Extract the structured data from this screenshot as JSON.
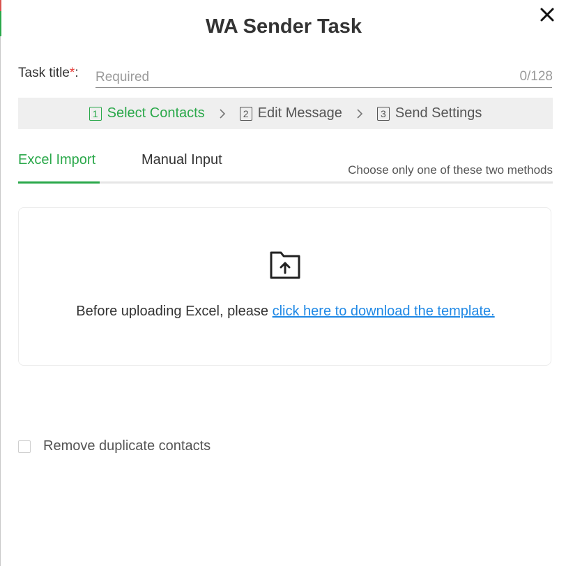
{
  "dialog": {
    "title": "WA Sender Task",
    "close_label": "✕"
  },
  "task_title": {
    "label": "Task title",
    "required_mark": "*",
    "colon": ":",
    "placeholder": "Required",
    "value": "",
    "counter": "0/128"
  },
  "steps": [
    {
      "number": "1",
      "label": "Select Contacts",
      "active": true
    },
    {
      "number": "2",
      "label": "Edit Message",
      "active": false
    },
    {
      "number": "3",
      "label": "Send Settings",
      "active": false
    }
  ],
  "tabs": {
    "items": [
      {
        "label": "Excel Import",
        "active": true
      },
      {
        "label": "Manual Input",
        "active": false
      }
    ],
    "hint": "Choose only one of these two methods"
  },
  "upload": {
    "icon": "folder-upload-icon",
    "text_prefix": "Before uploading Excel, please ",
    "link_text": "click here to download the template."
  },
  "options": {
    "dedup_label": "Remove duplicate contacts",
    "dedup_checked": false
  },
  "colors": {
    "accent": "#2aa84a",
    "link": "#1e88e5",
    "required": "#e53935",
    "steps_bg": "#efefef"
  }
}
